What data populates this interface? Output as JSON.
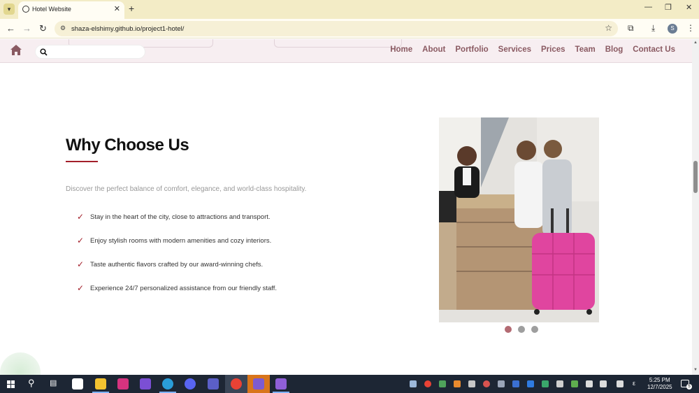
{
  "browser": {
    "tab_title": "Hotel Website",
    "url": "shaza-elshimy.github.io/project1-hotel/",
    "profile_initial": "S"
  },
  "nav": {
    "menu": [
      "Home",
      "About",
      "Portfolio",
      "Services",
      "Prices",
      "Team",
      "Blog",
      "Contact Us"
    ],
    "search_placeholder": ""
  },
  "section": {
    "title": "Why Choose Us",
    "lead": "Discover the perfect balance of comfort, elegance, and world-class hospitality.",
    "features": [
      "Stay in the heart of the city, close to attractions and transport.",
      "Enjoy stylish rooms with modern amenities and cozy interiors.",
      "Taste authentic flavors crafted by our award-winning chefs.",
      "Experience 24/7 personalized assistance from our friendly staff."
    ],
    "carousel": {
      "slides": 3,
      "active_index": 0
    }
  },
  "taskbar": {
    "time": "5:25 PM",
    "date": "12/7/2025",
    "notification_count": "5"
  },
  "colors": {
    "accent": "#a31f2a",
    "menu_text": "#8a5a62",
    "nav_bg": "#f7eef1",
    "chrome_bg": "#f3ecc6",
    "taskbar_bg": "#1d2634"
  }
}
